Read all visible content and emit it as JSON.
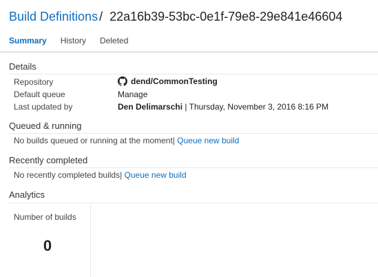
{
  "header": {
    "breadcrumb_link": "Build Definitions",
    "separator": "/",
    "definition_id": "22a16b39-53bc-0e1f-79e8-29e841e46604"
  },
  "tabs": [
    {
      "label": "Summary",
      "active": true
    },
    {
      "label": "History",
      "active": false
    },
    {
      "label": "Deleted",
      "active": false
    }
  ],
  "details": {
    "title": "Details",
    "repository_label": "Repository",
    "repository_value": "dend/CommonTesting",
    "repository_icon": "github-icon",
    "queue_label": "Default queue",
    "queue_value": "Manage",
    "updated_label": "Last updated by",
    "updated_user": "Den Delimarschi",
    "updated_date": " | Thursday, November 3, 2016 8:16 PM"
  },
  "queued": {
    "title": "Queued & running",
    "message": "No builds queued or running at the moment|",
    "link": "Queue new build"
  },
  "recent": {
    "title": "Recently completed",
    "message": "No recently completed builds|",
    "link": "Queue new build"
  },
  "analytics": {
    "title": "Analytics",
    "label": "Number of builds",
    "value": "0"
  }
}
